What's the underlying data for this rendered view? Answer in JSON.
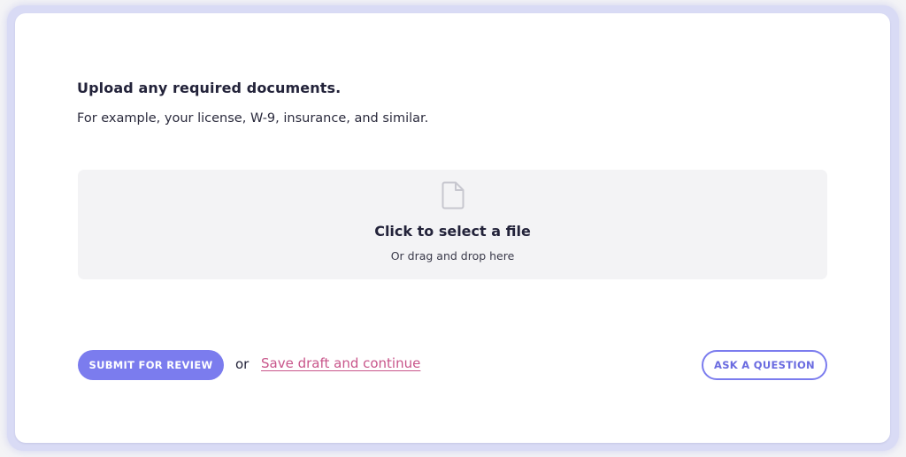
{
  "section": {
    "heading": "Upload any required documents.",
    "description": "For example, your license, W-9, insurance, and similar."
  },
  "dropzone": {
    "icon": "file-icon",
    "title": "Click to select a file",
    "subtitle": "Or drag and drop here"
  },
  "actions": {
    "submit_label": "SUBMIT FOR REVIEW",
    "separator": "or",
    "save_draft_label": "Save draft and continue",
    "ask_label": "ASK A QUESTION"
  },
  "colors": {
    "accent": "#7b7cee",
    "link": "#c8558a",
    "dropzone_bg": "#f3f3f5",
    "text": "#23233a"
  }
}
